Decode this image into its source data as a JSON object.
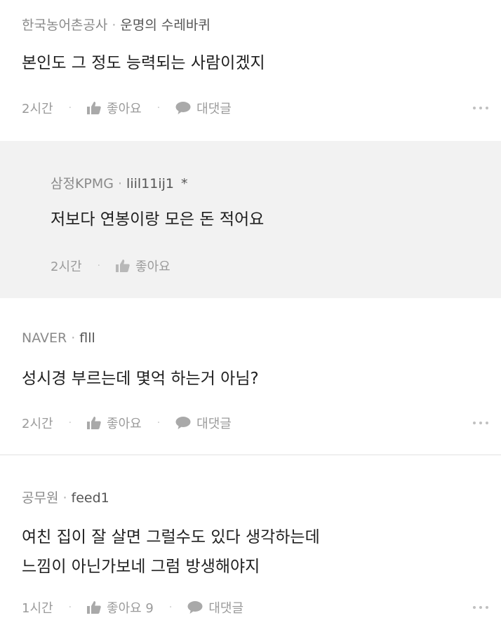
{
  "comments": [
    {
      "company": "한국농어촌공사",
      "nickname": "운명의 수레바퀴",
      "text": "본인도 그 정도 능력되는 사람이겠지",
      "time": "2시간",
      "like": "좋아요",
      "reply": "대댓글"
    },
    {
      "company": "삼정KPMG",
      "nickname": "liil11ij1",
      "star": "*",
      "text": "저보다 연봉이랑 모은 돈 적어요",
      "time": "2시간",
      "like": "좋아요"
    },
    {
      "company": "NAVER",
      "nickname": "flll",
      "text": "성시경 부르는데 몇억 하는거 아님?",
      "time": "2시간",
      "like": "좋아요",
      "reply": "대댓글"
    },
    {
      "company": "공무원",
      "nickname": "feed1",
      "text_lines": [
        "여친 집이 잘 살면 그럴수도 있다 생각하는데",
        "느낌이 아닌가보네 그럼 방생해야지"
      ],
      "time": "1시간",
      "like": "좋아요 9",
      "reply": "대댓글"
    }
  ],
  "separator": "·",
  "icons": {
    "like": "thumbs-up-icon",
    "reply": "speech-bubble-icon",
    "more": "more-dots-icon"
  },
  "colors": {
    "reply_background": "#f2f2f2",
    "meta_text": "#8a8a8a",
    "action_text": "#9b9b9b"
  }
}
